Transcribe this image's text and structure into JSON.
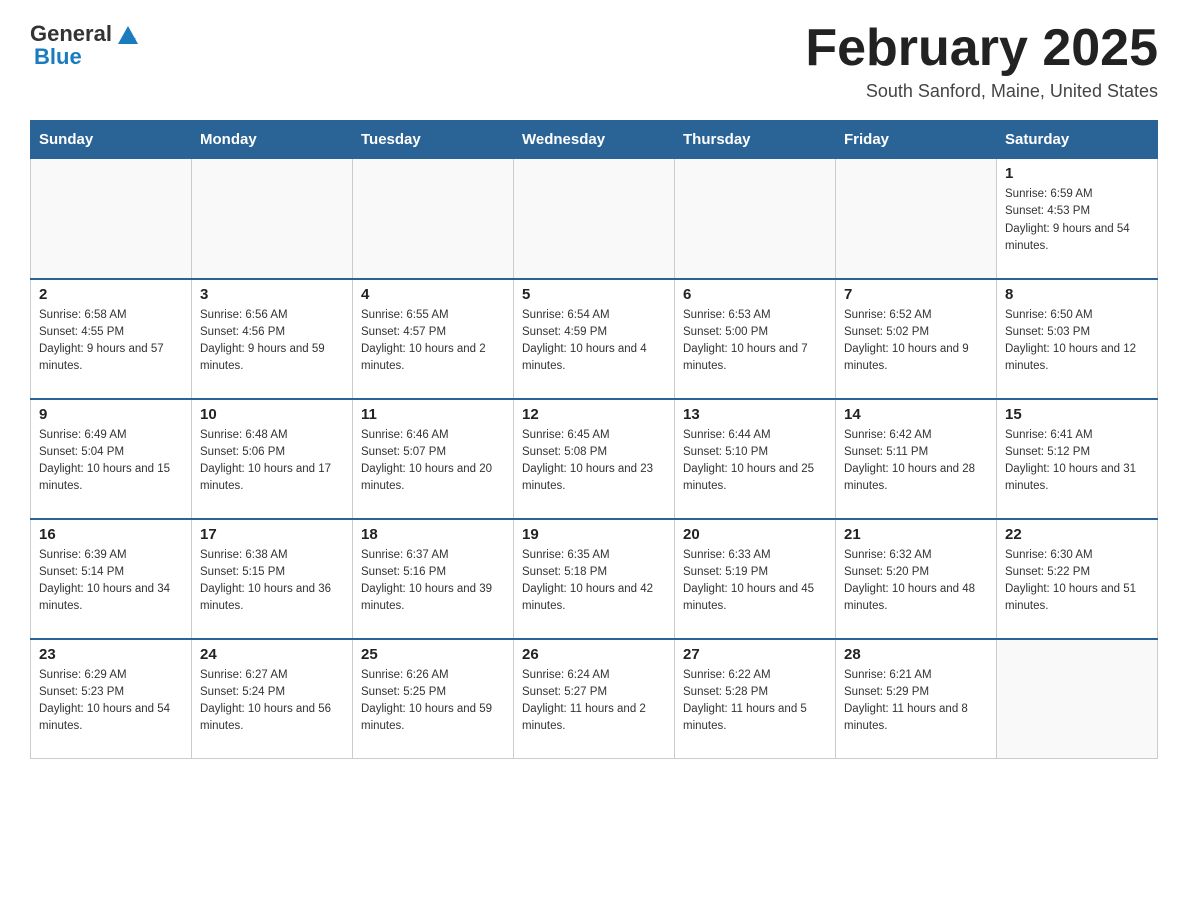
{
  "header": {
    "logo_general": "General",
    "logo_blue": "Blue",
    "month_title": "February 2025",
    "location": "South Sanford, Maine, United States"
  },
  "days_of_week": [
    "Sunday",
    "Monday",
    "Tuesday",
    "Wednesday",
    "Thursday",
    "Friday",
    "Saturday"
  ],
  "weeks": [
    [
      {
        "day": "",
        "info": ""
      },
      {
        "day": "",
        "info": ""
      },
      {
        "day": "",
        "info": ""
      },
      {
        "day": "",
        "info": ""
      },
      {
        "day": "",
        "info": ""
      },
      {
        "day": "",
        "info": ""
      },
      {
        "day": "1",
        "info": "Sunrise: 6:59 AM\nSunset: 4:53 PM\nDaylight: 9 hours and 54 minutes."
      }
    ],
    [
      {
        "day": "2",
        "info": "Sunrise: 6:58 AM\nSunset: 4:55 PM\nDaylight: 9 hours and 57 minutes."
      },
      {
        "day": "3",
        "info": "Sunrise: 6:56 AM\nSunset: 4:56 PM\nDaylight: 9 hours and 59 minutes."
      },
      {
        "day": "4",
        "info": "Sunrise: 6:55 AM\nSunset: 4:57 PM\nDaylight: 10 hours and 2 minutes."
      },
      {
        "day": "5",
        "info": "Sunrise: 6:54 AM\nSunset: 4:59 PM\nDaylight: 10 hours and 4 minutes."
      },
      {
        "day": "6",
        "info": "Sunrise: 6:53 AM\nSunset: 5:00 PM\nDaylight: 10 hours and 7 minutes."
      },
      {
        "day": "7",
        "info": "Sunrise: 6:52 AM\nSunset: 5:02 PM\nDaylight: 10 hours and 9 minutes."
      },
      {
        "day": "8",
        "info": "Sunrise: 6:50 AM\nSunset: 5:03 PM\nDaylight: 10 hours and 12 minutes."
      }
    ],
    [
      {
        "day": "9",
        "info": "Sunrise: 6:49 AM\nSunset: 5:04 PM\nDaylight: 10 hours and 15 minutes."
      },
      {
        "day": "10",
        "info": "Sunrise: 6:48 AM\nSunset: 5:06 PM\nDaylight: 10 hours and 17 minutes."
      },
      {
        "day": "11",
        "info": "Sunrise: 6:46 AM\nSunset: 5:07 PM\nDaylight: 10 hours and 20 minutes."
      },
      {
        "day": "12",
        "info": "Sunrise: 6:45 AM\nSunset: 5:08 PM\nDaylight: 10 hours and 23 minutes."
      },
      {
        "day": "13",
        "info": "Sunrise: 6:44 AM\nSunset: 5:10 PM\nDaylight: 10 hours and 25 minutes."
      },
      {
        "day": "14",
        "info": "Sunrise: 6:42 AM\nSunset: 5:11 PM\nDaylight: 10 hours and 28 minutes."
      },
      {
        "day": "15",
        "info": "Sunrise: 6:41 AM\nSunset: 5:12 PM\nDaylight: 10 hours and 31 minutes."
      }
    ],
    [
      {
        "day": "16",
        "info": "Sunrise: 6:39 AM\nSunset: 5:14 PM\nDaylight: 10 hours and 34 minutes."
      },
      {
        "day": "17",
        "info": "Sunrise: 6:38 AM\nSunset: 5:15 PM\nDaylight: 10 hours and 36 minutes."
      },
      {
        "day": "18",
        "info": "Sunrise: 6:37 AM\nSunset: 5:16 PM\nDaylight: 10 hours and 39 minutes."
      },
      {
        "day": "19",
        "info": "Sunrise: 6:35 AM\nSunset: 5:18 PM\nDaylight: 10 hours and 42 minutes."
      },
      {
        "day": "20",
        "info": "Sunrise: 6:33 AM\nSunset: 5:19 PM\nDaylight: 10 hours and 45 minutes."
      },
      {
        "day": "21",
        "info": "Sunrise: 6:32 AM\nSunset: 5:20 PM\nDaylight: 10 hours and 48 minutes."
      },
      {
        "day": "22",
        "info": "Sunrise: 6:30 AM\nSunset: 5:22 PM\nDaylight: 10 hours and 51 minutes."
      }
    ],
    [
      {
        "day": "23",
        "info": "Sunrise: 6:29 AM\nSunset: 5:23 PM\nDaylight: 10 hours and 54 minutes."
      },
      {
        "day": "24",
        "info": "Sunrise: 6:27 AM\nSunset: 5:24 PM\nDaylight: 10 hours and 56 minutes."
      },
      {
        "day": "25",
        "info": "Sunrise: 6:26 AM\nSunset: 5:25 PM\nDaylight: 10 hours and 59 minutes."
      },
      {
        "day": "26",
        "info": "Sunrise: 6:24 AM\nSunset: 5:27 PM\nDaylight: 11 hours and 2 minutes."
      },
      {
        "day": "27",
        "info": "Sunrise: 6:22 AM\nSunset: 5:28 PM\nDaylight: 11 hours and 5 minutes."
      },
      {
        "day": "28",
        "info": "Sunrise: 6:21 AM\nSunset: 5:29 PM\nDaylight: 11 hours and 8 minutes."
      },
      {
        "day": "",
        "info": ""
      }
    ]
  ]
}
